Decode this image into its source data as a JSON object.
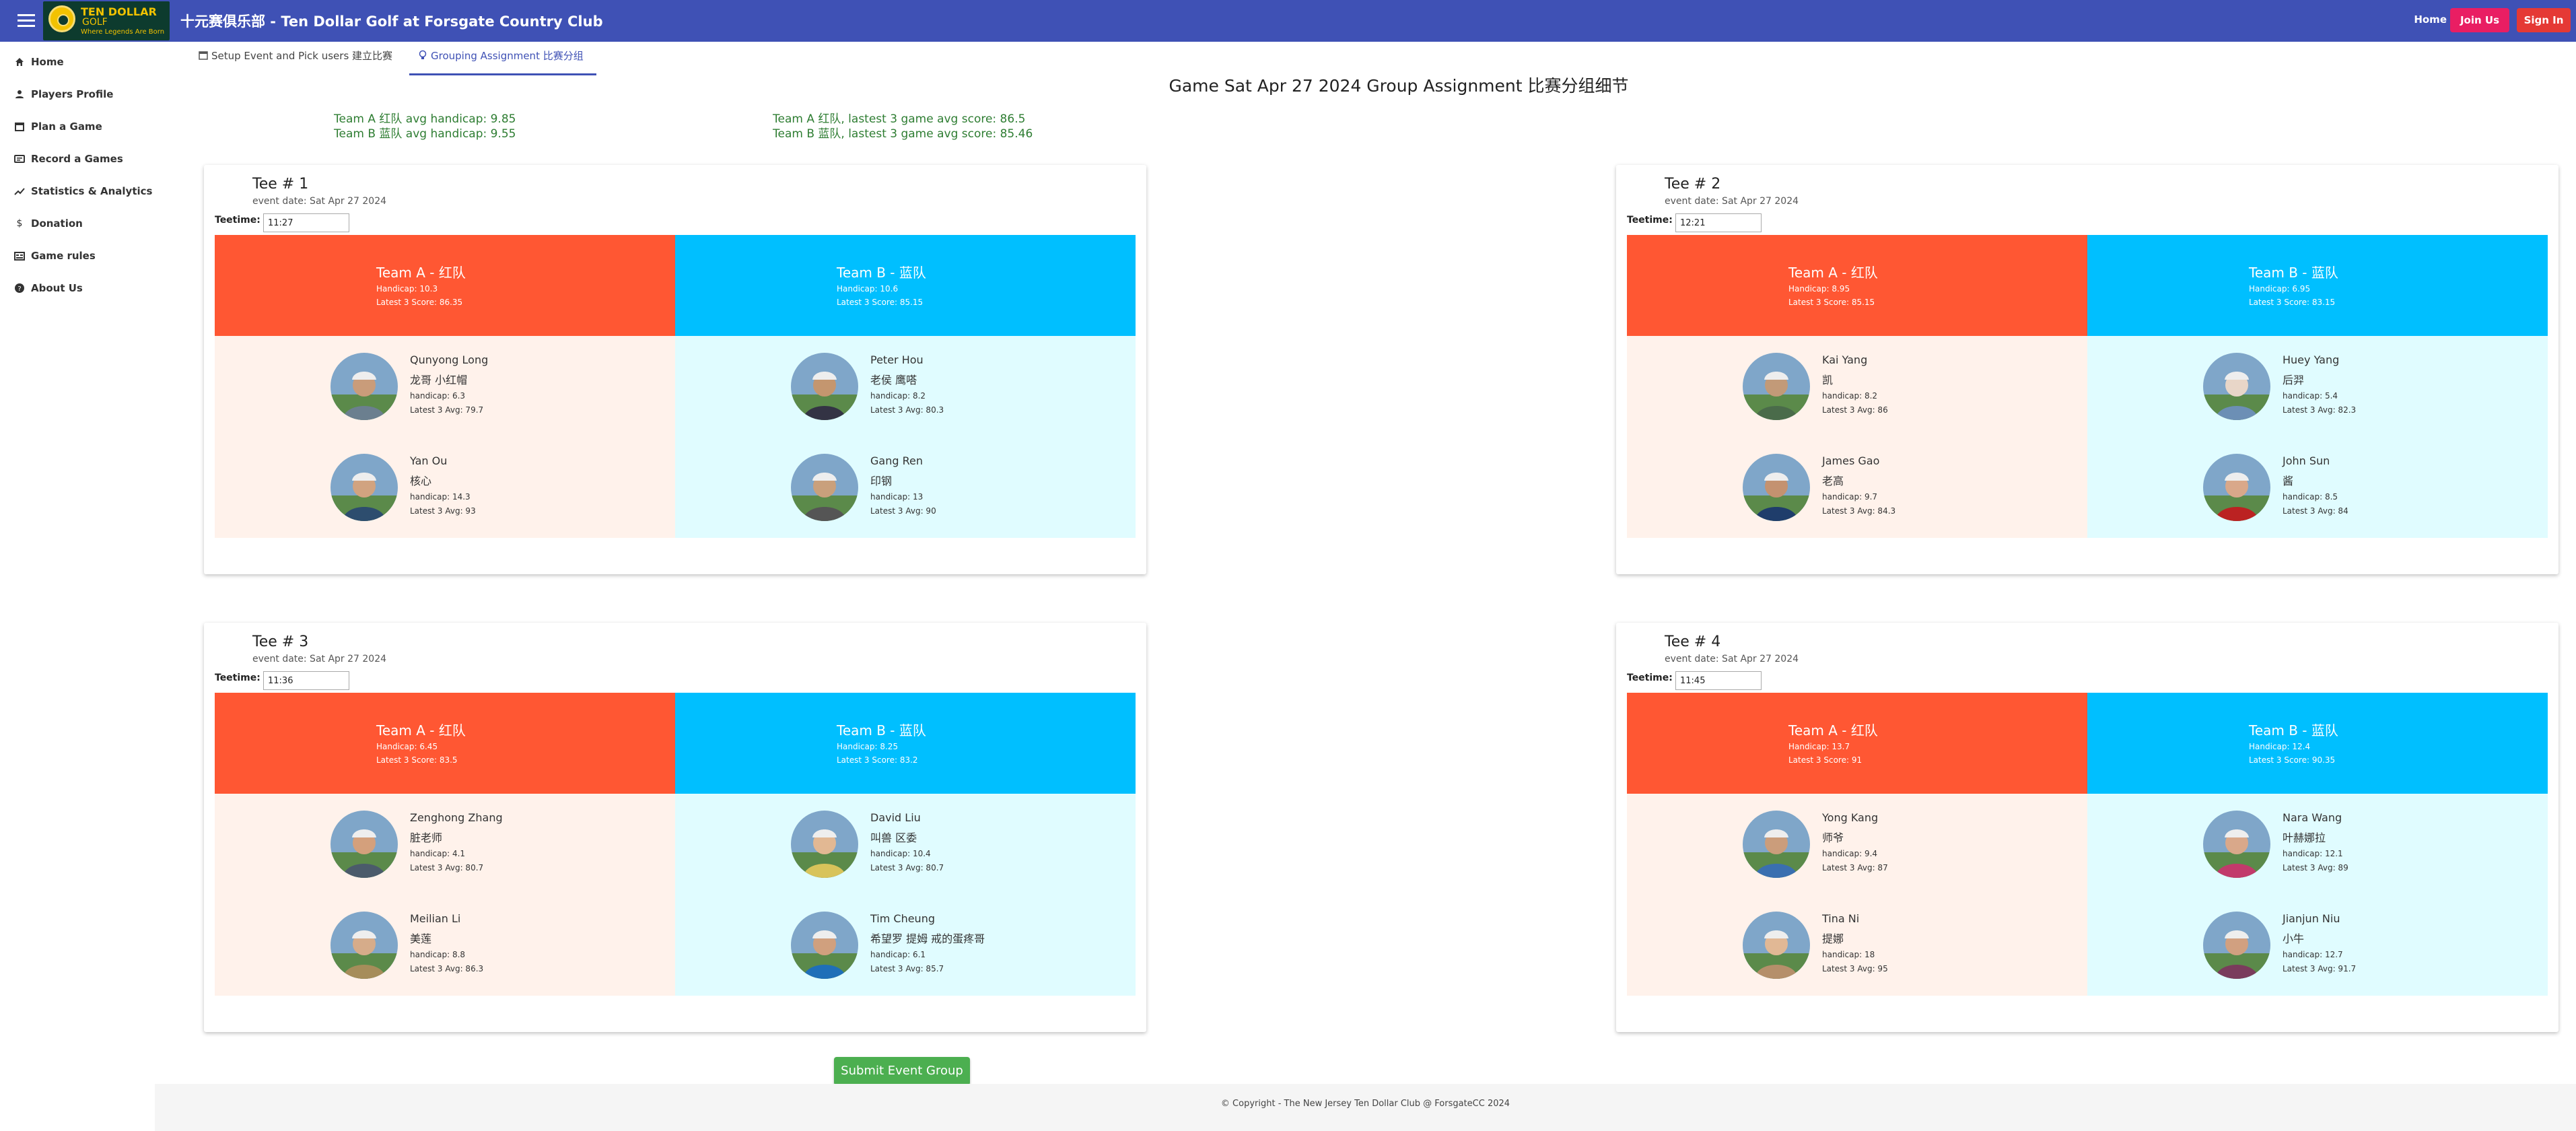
{
  "header": {
    "logo_line1": "TEN DOLLAR",
    "logo_line2": "GOLF",
    "logo_tagline": "Where Legends Are Born",
    "title": "十元赛俱乐部 - Ten Dollar Golf at Forsgate Country Club",
    "home": "Home",
    "join": "Join Us",
    "signin": "Sign In"
  },
  "sidebar": {
    "items": [
      {
        "label": "Home",
        "icon": "home-icon"
      },
      {
        "label": "Players Profile",
        "icon": "person-icon"
      },
      {
        "label": "Plan a Game",
        "icon": "calendar-icon"
      },
      {
        "label": "Record a Games",
        "icon": "scorecard-icon"
      },
      {
        "label": "Statistics & Analytics",
        "icon": "trend-icon"
      },
      {
        "label": "Donation",
        "icon": "dollar-icon"
      },
      {
        "label": "Game rules",
        "icon": "rules-icon"
      },
      {
        "label": "About Us",
        "icon": "help-icon"
      }
    ]
  },
  "tabs": [
    {
      "label": "Setup Event and Pick users 建立比赛",
      "icon": "calendar-icon"
    },
    {
      "label": "Grouping Assignment 比赛分组",
      "icon": "lightbulb-icon"
    }
  ],
  "page": {
    "title": "Game Sat Apr 27 2024 Group Assignment 比赛分组细节",
    "stats": {
      "a_handicap": "Team A 红队 avg handicap: 9.85",
      "b_handicap": "Team B 蓝队 avg handicap: 9.55",
      "a_score": "Team A 红队, lastest 3 game avg score: 86.5",
      "b_score": "Team B 蓝队, lastest 3 game avg score: 85.46"
    }
  },
  "colors": {
    "team_a": "#ff5733",
    "team_b": "#00bfff",
    "team_a_row": "#fff2eb",
    "team_b_row": "#e0fcff",
    "brand": "#3f51b5"
  },
  "groups": [
    {
      "tee": "Tee # 1",
      "date": "event date: Sat Apr 27 2024",
      "teetime_label": "Teetime:",
      "teetime": "11:27",
      "team_a": {
        "name": "Team A - 红队",
        "handicap": "Handicap: 10.3",
        "score": "Latest 3 Score: 86.35",
        "players": [
          {
            "name": "Qunyong Long",
            "cn": "龙哥 小红帽",
            "handicap": "handicap: 6.3",
            "avg": "Latest 3 Avg: 79.7"
          },
          {
            "name": "Yan Ou",
            "cn": "核心",
            "handicap": "handicap: 14.3",
            "avg": "Latest 3 Avg: 93"
          }
        ]
      },
      "team_b": {
        "name": "Team B - 蓝队",
        "handicap": "Handicap: 10.6",
        "score": "Latest 3 Score: 85.15",
        "players": [
          {
            "name": "Peter Hou",
            "cn": "老侯 鹰嗒",
            "handicap": "handicap: 8.2",
            "avg": "Latest 3 Avg: 80.3"
          },
          {
            "name": "Gang Ren",
            "cn": "印钢",
            "handicap": "handicap: 13",
            "avg": "Latest 3 Avg: 90"
          }
        ]
      }
    },
    {
      "tee": "Tee # 2",
      "date": "event date: Sat Apr 27 2024",
      "teetime_label": "Teetime:",
      "teetime": "12:21",
      "team_a": {
        "name": "Team A - 红队",
        "handicap": "Handicap: 8.95",
        "score": "Latest 3 Score: 85.15",
        "players": [
          {
            "name": "Kai Yang",
            "cn": "凯",
            "handicap": "handicap: 8.2",
            "avg": "Latest 3 Avg: 86"
          },
          {
            "name": "James Gao",
            "cn": "老高",
            "handicap": "handicap: 9.7",
            "avg": "Latest 3 Avg: 84.3"
          }
        ]
      },
      "team_b": {
        "name": "Team B - 蓝队",
        "handicap": "Handicap: 6.95",
        "score": "Latest 3 Score: 83.15",
        "players": [
          {
            "name": "Huey Yang",
            "cn": "后羿",
            "handicap": "handicap: 5.4",
            "avg": "Latest 3 Avg: 82.3"
          },
          {
            "name": "John Sun",
            "cn": "酱",
            "handicap": "handicap: 8.5",
            "avg": "Latest 3 Avg: 84"
          }
        ]
      }
    },
    {
      "tee": "Tee # 3",
      "date": "event date: Sat Apr 27 2024",
      "teetime_label": "Teetime:",
      "teetime": "11:36",
      "team_a": {
        "name": "Team A - 红队",
        "handicap": "Handicap: 6.45",
        "score": "Latest 3 Score: 83.5",
        "players": [
          {
            "name": "Zenghong Zhang",
            "cn": "脏老师",
            "handicap": "handicap: 4.1",
            "avg": "Latest 3 Avg: 80.7"
          },
          {
            "name": "Meilian Li",
            "cn": "美莲",
            "handicap": "handicap: 8.8",
            "avg": "Latest 3 Avg: 86.3"
          }
        ]
      },
      "team_b": {
        "name": "Team B - 蓝队",
        "handicap": "Handicap: 8.25",
        "score": "Latest 3 Score: 83.2",
        "players": [
          {
            "name": "David Liu",
            "cn": "叫兽 区委",
            "handicap": "handicap: 10.4",
            "avg": "Latest 3 Avg: 80.7"
          },
          {
            "name": "Tim Cheung",
            "cn": "希望罗 提姆 戒的蛋疼哥",
            "handicap": "handicap: 6.1",
            "avg": "Latest 3 Avg: 85.7"
          }
        ]
      }
    },
    {
      "tee": "Tee # 4",
      "date": "event date: Sat Apr 27 2024",
      "teetime_label": "Teetime:",
      "teetime": "11:45",
      "team_a": {
        "name": "Team A - 红队",
        "handicap": "Handicap: 13.7",
        "score": "Latest 3 Score: 91",
        "players": [
          {
            "name": "Yong Kang",
            "cn": "师爷",
            "handicap": "handicap: 9.4",
            "avg": "Latest 3 Avg: 87"
          },
          {
            "name": "Tina Ni",
            "cn": "提娜",
            "handicap": "handicap: 18",
            "avg": "Latest 3 Avg: 95"
          }
        ]
      },
      "team_b": {
        "name": "Team B - 蓝队",
        "handicap": "Handicap: 12.4",
        "score": "Latest 3 Score: 90.35",
        "players": [
          {
            "name": "Nara Wang",
            "cn": "叶赫娜拉",
            "handicap": "handicap: 12.1",
            "avg": "Latest 3 Avg: 89"
          },
          {
            "name": "Jianjun Niu",
            "cn": "小牛",
            "handicap": "handicap: 12.7",
            "avg": "Latest 3 Avg: 91.7"
          }
        ]
      }
    }
  ],
  "submit": "Submit Event Group",
  "footer": "© Copyright - The New Jersey Ten Dollar Club @ ForsgateCC 2024"
}
